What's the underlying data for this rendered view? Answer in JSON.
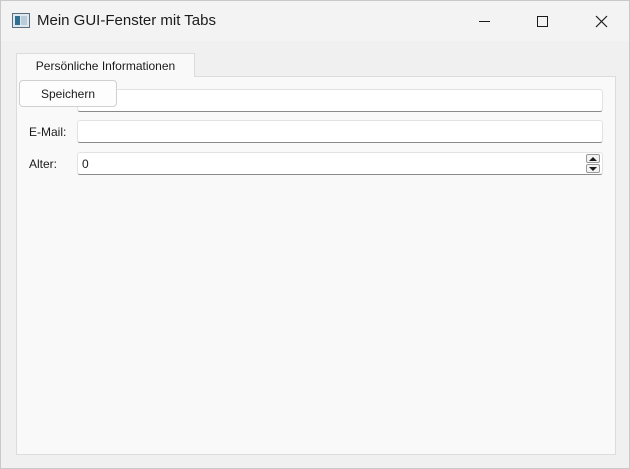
{
  "window": {
    "title": "Mein GUI-Fenster mit Tabs",
    "icon": "app-window-icon",
    "controls": {
      "minimize": "minimize-icon",
      "maximize": "maximize-icon",
      "close": "close-icon"
    }
  },
  "tabs": [
    {
      "label": "Persönliche Informationen",
      "active": true
    }
  ],
  "form": {
    "save_label": "Speichern",
    "name": {
      "value": ""
    },
    "email": {
      "label": "E-Mail:",
      "value": ""
    },
    "age": {
      "label": "Alter:",
      "value": "0"
    }
  },
  "colors": {
    "window_bg": "#f0f0f0",
    "pane_bg": "#f9f9f9",
    "border": "#dcdcdc",
    "text": "#1b1b1b"
  }
}
